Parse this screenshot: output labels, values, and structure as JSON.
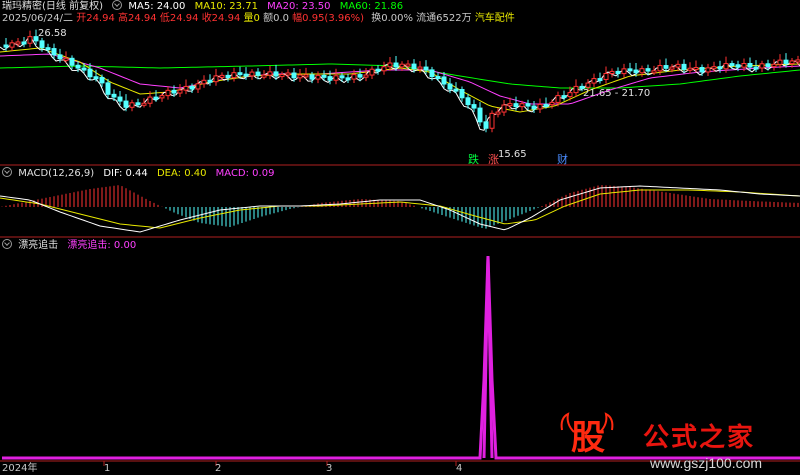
{
  "header": {
    "stock_name": "瑞玛精密(日线 前复权)",
    "ma5": "MA5: 24.00",
    "ma10": "MA10: 23.71",
    "ma20": "MA20: 23.50",
    "ma60": "MA60: 21.86"
  },
  "quote": {
    "date": "2025/06/24/二",
    "open": "开24.94",
    "high": "高24.94",
    "low": "低24.94",
    "close": "收24.94",
    "volume": "量0",
    "amount": "额0.0",
    "change": "幅0.95(3.96%)",
    "turnover": "换0.00%",
    "float": "流通6522万",
    "industry": "汽车配件"
  },
  "price_labels": {
    "high": "26.58",
    "low": "15.65",
    "range": "21.65 - 21.70",
    "tag_die": "跌",
    "tag_zhang": "涨",
    "tag_cai": "财"
  },
  "macd": {
    "label": "MACD(12,26,9)",
    "dif": "DIF: 0.44",
    "dea": "DEA: 0.40",
    "macd": "MACD: 0.09"
  },
  "indicator": {
    "name": "漂亮追击",
    "value": "漂亮追击: 0.00"
  },
  "xaxis": {
    "labels": [
      "2024年",
      "1",
      "2",
      "3",
      "4"
    ]
  },
  "watermark": {
    "badge": "股",
    "title": "公式之家",
    "url": "www.gszj100.com"
  },
  "colors": {
    "up": "#ff3232",
    "down": "#54ffff",
    "ma5": "#ffffff",
    "ma10": "#e8e800",
    "ma20": "#ff40ff",
    "ma60": "#00ff00",
    "spike": "#e020e0",
    "divider": "#b02020"
  },
  "chart_data": {
    "type": "line",
    "title": "漂亮追击",
    "series": [
      {
        "name": "漂亮追击",
        "x": [
          "2024年",
          "1",
          "2",
          "3",
          "4"
        ],
        "values": [
          0,
          0,
          0,
          0,
          0
        ]
      }
    ],
    "note_spike": "single spike to maximum shortly after 4"
  }
}
